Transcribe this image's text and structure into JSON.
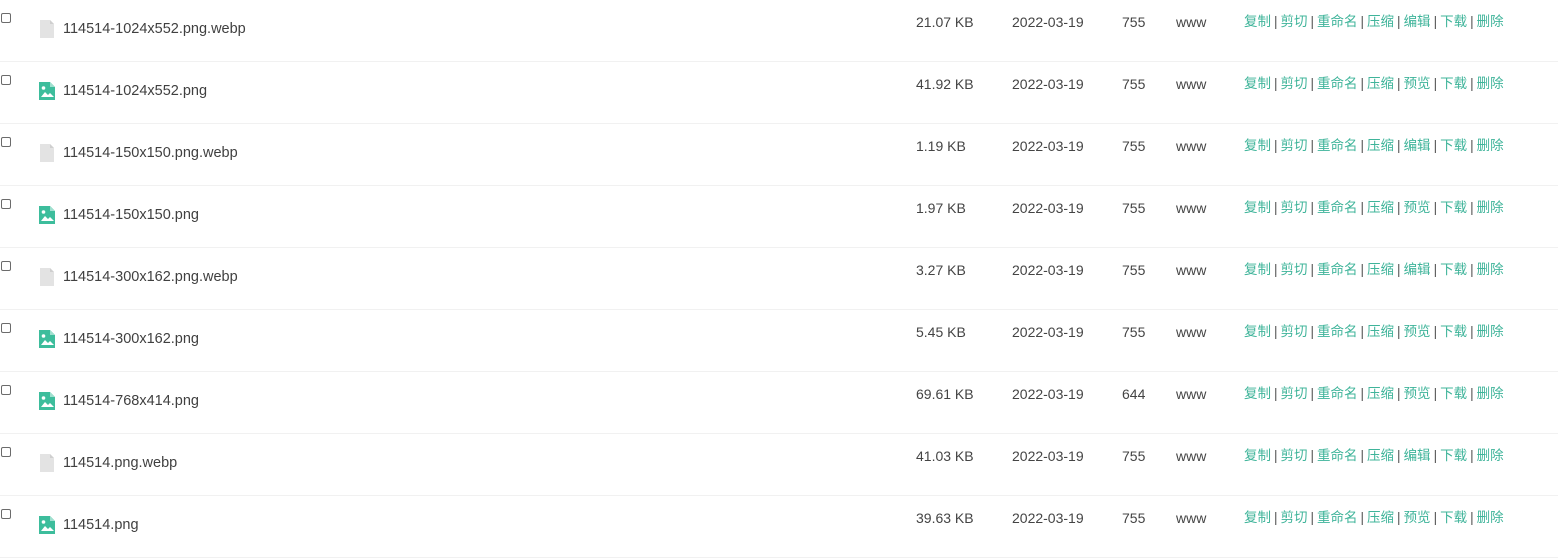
{
  "files": [
    {
      "name": "114514-1024x552.png.webp",
      "type": "file",
      "size": "21.07 KB",
      "date": "2022-03-19",
      "perm": "755",
      "owner": "www",
      "actions": [
        "复制",
        "剪切",
        "重命名",
        "压缩",
        "编辑",
        "下载",
        "删除"
      ]
    },
    {
      "name": "114514-1024x552.png",
      "type": "image",
      "size": "41.92 KB",
      "date": "2022-03-19",
      "perm": "755",
      "owner": "www",
      "actions": [
        "复制",
        "剪切",
        "重命名",
        "压缩",
        "预览",
        "下载",
        "删除"
      ]
    },
    {
      "name": "114514-150x150.png.webp",
      "type": "file",
      "size": "1.19 KB",
      "date": "2022-03-19",
      "perm": "755",
      "owner": "www",
      "actions": [
        "复制",
        "剪切",
        "重命名",
        "压缩",
        "编辑",
        "下载",
        "删除"
      ]
    },
    {
      "name": "114514-150x150.png",
      "type": "image",
      "size": "1.97 KB",
      "date": "2022-03-19",
      "perm": "755",
      "owner": "www",
      "actions": [
        "复制",
        "剪切",
        "重命名",
        "压缩",
        "预览",
        "下载",
        "删除"
      ]
    },
    {
      "name": "114514-300x162.png.webp",
      "type": "file",
      "size": "3.27 KB",
      "date": "2022-03-19",
      "perm": "755",
      "owner": "www",
      "actions": [
        "复制",
        "剪切",
        "重命名",
        "压缩",
        "编辑",
        "下载",
        "删除"
      ]
    },
    {
      "name": "114514-300x162.png",
      "type": "image",
      "size": "5.45 KB",
      "date": "2022-03-19",
      "perm": "755",
      "owner": "www",
      "actions": [
        "复制",
        "剪切",
        "重命名",
        "压缩",
        "预览",
        "下载",
        "删除"
      ]
    },
    {
      "name": "114514-768x414.png",
      "type": "image",
      "size": "69.61 KB",
      "date": "2022-03-19",
      "perm": "644",
      "owner": "www",
      "actions": [
        "复制",
        "剪切",
        "重命名",
        "压缩",
        "预览",
        "下载",
        "删除"
      ]
    },
    {
      "name": "114514.png.webp",
      "type": "file",
      "size": "41.03 KB",
      "date": "2022-03-19",
      "perm": "755",
      "owner": "www",
      "actions": [
        "复制",
        "剪切",
        "重命名",
        "压缩",
        "编辑",
        "下载",
        "删除"
      ]
    },
    {
      "name": "114514.png",
      "type": "image",
      "size": "39.63 KB",
      "date": "2022-03-19",
      "perm": "755",
      "owner": "www",
      "actions": [
        "复制",
        "剪切",
        "重命名",
        "压缩",
        "预览",
        "下载",
        "删除"
      ]
    }
  ],
  "colors": {
    "action_link": "#3fb49a",
    "image_icon": "#3dbd9c",
    "file_icon": "#e3e3e3"
  }
}
